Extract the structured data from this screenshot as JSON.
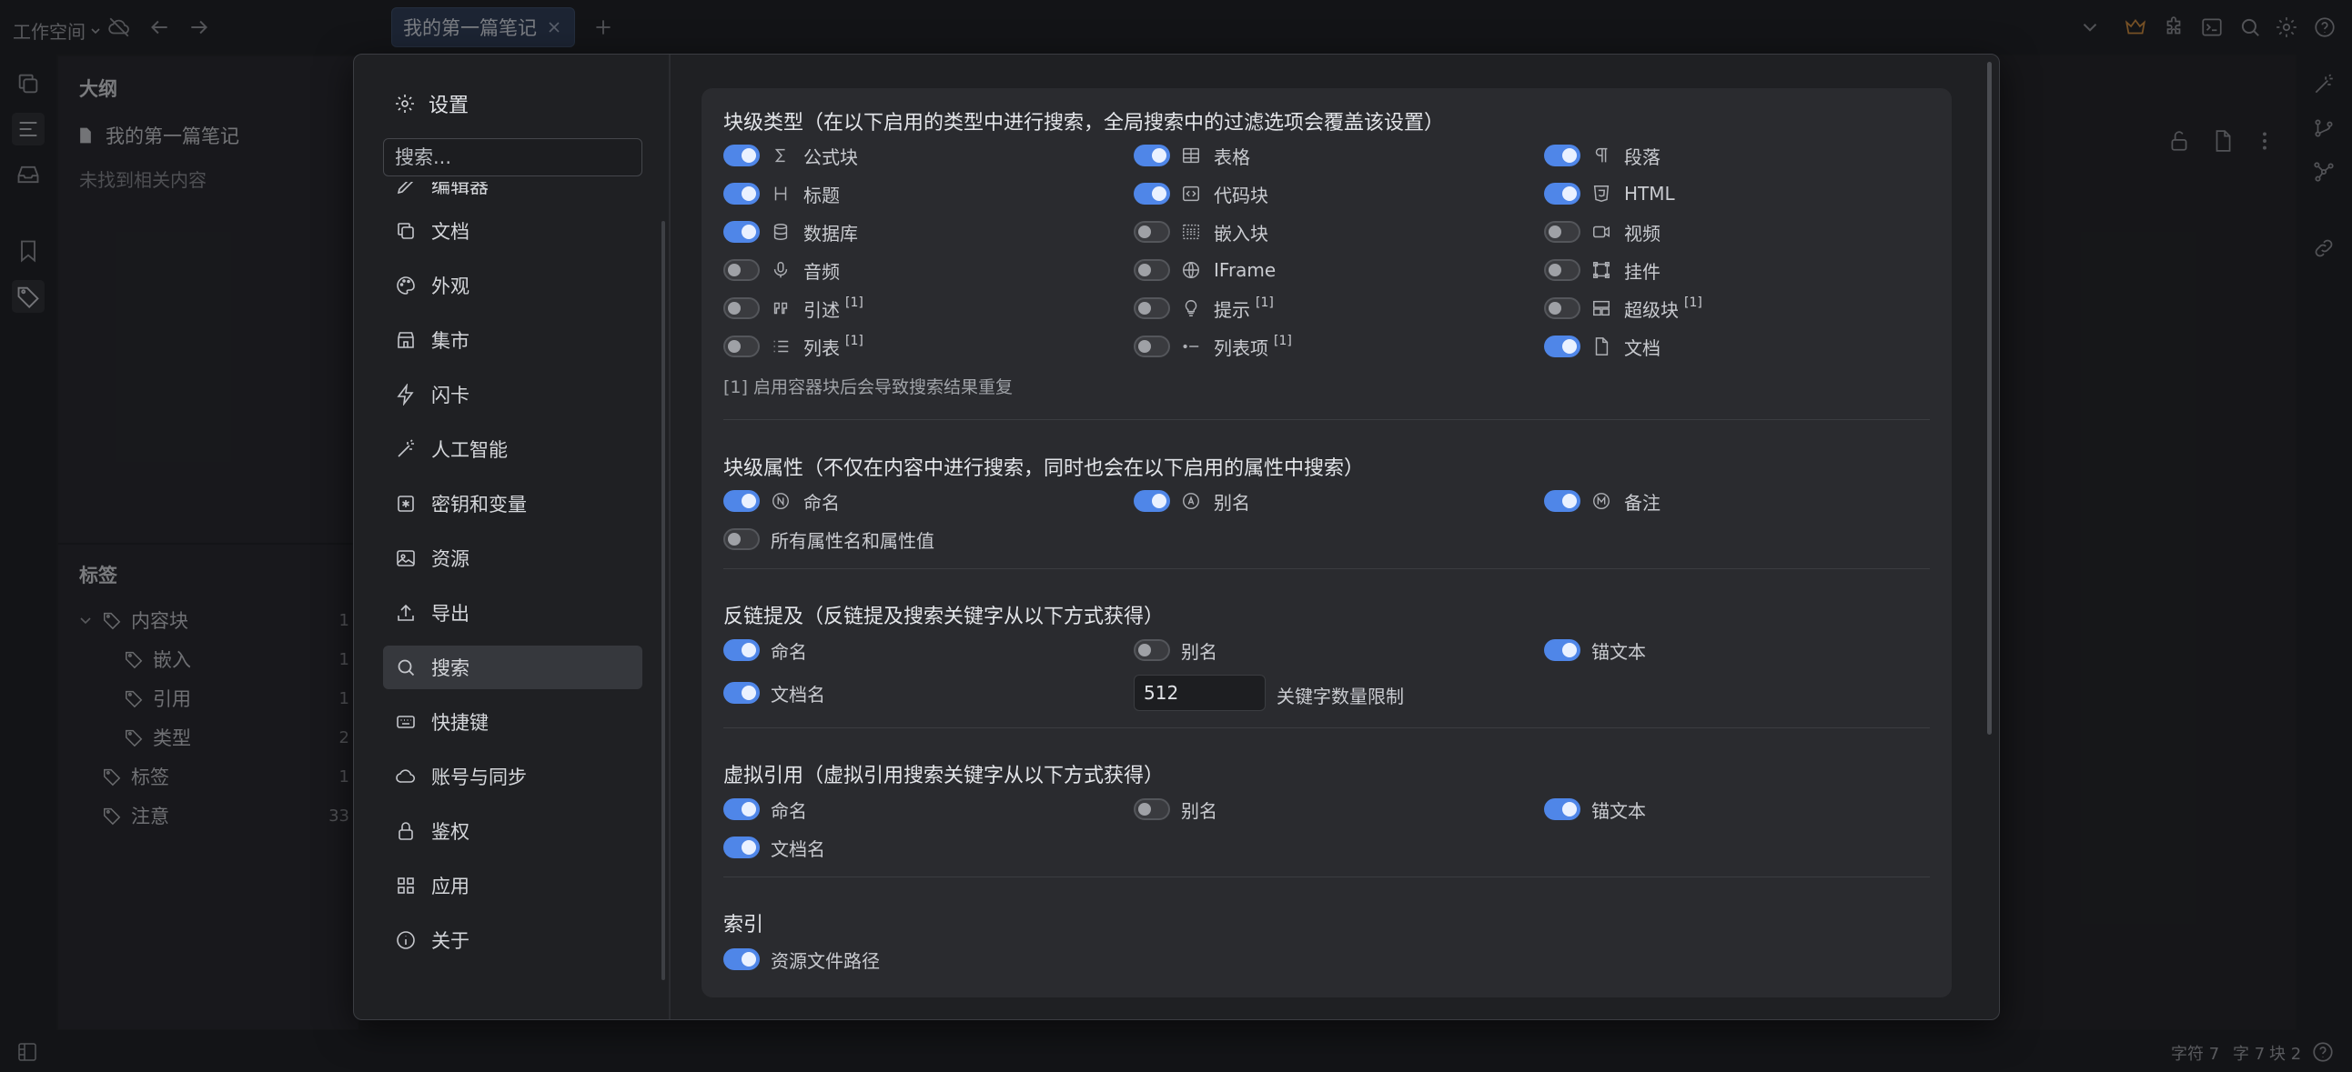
{
  "topbar": {
    "workspace": "工作空间",
    "tab_title": "我的第一篇笔记"
  },
  "outline": {
    "title": "大纲",
    "doc_title": "我的第一篇笔记",
    "empty_text": "未找到相关内容"
  },
  "tags": {
    "title": "标签",
    "items": [
      {
        "label": "内容块",
        "count": "1"
      },
      {
        "label": "嵌入",
        "count": "1"
      },
      {
        "label": "引用",
        "count": "1"
      },
      {
        "label": "类型",
        "count": "2"
      },
      {
        "label": "标签",
        "count": "1"
      },
      {
        "label": "注意",
        "count": "33"
      }
    ]
  },
  "status": {
    "chars": "字符 7",
    "words": "字 7",
    "blocks": "块 2"
  },
  "dialog": {
    "title": "设置",
    "search_placeholder": "搜索...",
    "nav": [
      {
        "label": "编辑器",
        "icon": "pen-icon"
      },
      {
        "label": "文档",
        "icon": "files-icon"
      },
      {
        "label": "外观",
        "icon": "palette-icon"
      },
      {
        "label": "集市",
        "icon": "store-icon"
      },
      {
        "label": "闪卡",
        "icon": "bolt-icon"
      },
      {
        "label": "人工智能",
        "icon": "magic-wand-icon"
      },
      {
        "label": "密钥和变量",
        "icon": "key-icon"
      },
      {
        "label": "资源",
        "icon": "image-icon"
      },
      {
        "label": "导出",
        "icon": "upload-icon"
      },
      {
        "label": "搜索",
        "icon": "search-icon"
      },
      {
        "label": "快捷键",
        "icon": "keyboard-icon"
      },
      {
        "label": "账号与同步",
        "icon": "cloud-icon"
      },
      {
        "label": "鉴权",
        "icon": "lock-icon"
      },
      {
        "label": "应用",
        "icon": "grid-icon"
      },
      {
        "label": "关于",
        "icon": "info-icon"
      }
    ],
    "active_nav": "搜索"
  },
  "search_settings": {
    "block_types": {
      "title": "块级类型（在以下启用的类型中进行搜索，全局搜索中的过滤选项会覆盖该设置）",
      "items": [
        {
          "label": "公式块",
          "icon": "sigma-icon",
          "on": true,
          "note": ""
        },
        {
          "label": "表格",
          "icon": "table-icon",
          "on": true,
          "note": ""
        },
        {
          "label": "段落",
          "icon": "paragraph-icon",
          "on": true,
          "note": ""
        },
        {
          "label": "标题",
          "icon": "heading-icon",
          "on": true,
          "note": ""
        },
        {
          "label": "代码块",
          "icon": "code-icon",
          "on": true,
          "note": ""
        },
        {
          "label": "HTML",
          "icon": "html5-icon",
          "on": true,
          "note": ""
        },
        {
          "label": "数据库",
          "icon": "database-icon",
          "on": true,
          "note": ""
        },
        {
          "label": "嵌入块",
          "icon": "embed-icon",
          "on": false,
          "note": ""
        },
        {
          "label": "视频",
          "icon": "video-icon",
          "on": false,
          "note": ""
        },
        {
          "label": "音频",
          "icon": "microphone-icon",
          "on": false,
          "note": ""
        },
        {
          "label": "IFrame",
          "icon": "globe-icon",
          "on": false,
          "note": ""
        },
        {
          "label": "挂件",
          "icon": "widget-icon",
          "on": false,
          "note": ""
        },
        {
          "label": "引述",
          "icon": "quote-icon",
          "on": false,
          "note": "[1]"
        },
        {
          "label": "提示",
          "icon": "lightbulb-icon",
          "on": false,
          "note": "[1]"
        },
        {
          "label": "超级块",
          "icon": "superblock-icon",
          "on": false,
          "note": "[1]"
        },
        {
          "label": "列表",
          "icon": "list-icon",
          "on": false,
          "note": "[1]"
        },
        {
          "label": "列表项",
          "icon": "list-item-icon",
          "on": false,
          "note": "[1]"
        },
        {
          "label": "文档",
          "icon": "file-icon",
          "on": true,
          "note": ""
        }
      ],
      "footnote": "[1] 启用容器块后会导致搜索结果重复"
    },
    "block_attrs": {
      "title": "块级属性（不仅在内容中进行搜索，同时也会在以下启用的属性中搜索）",
      "items": [
        {
          "label": "命名",
          "icon": "circle-n-icon",
          "on": true
        },
        {
          "label": "别名",
          "icon": "circle-a-icon",
          "on": true
        },
        {
          "label": "备注",
          "icon": "circle-m-icon",
          "on": true
        },
        {
          "label": "所有属性名和属性值",
          "icon": "",
          "on": false
        }
      ]
    },
    "backlinks": {
      "title": "反链提及（反链提及搜索关键字从以下方式获得）",
      "items": [
        {
          "label": "命名",
          "on": true
        },
        {
          "label": "别名",
          "on": false
        },
        {
          "label": "锚文本",
          "on": true
        },
        {
          "label": "文档名",
          "on": true
        }
      ],
      "keyword_limit_value": "512",
      "keyword_limit_label": "关键字数量限制"
    },
    "virtual_refs": {
      "title": "虚拟引用（虚拟引用搜索关键字从以下方式获得）",
      "items": [
        {
          "label": "命名",
          "on": true
        },
        {
          "label": "别名",
          "on": false
        },
        {
          "label": "锚文本",
          "on": true
        },
        {
          "label": "文档名",
          "on": true
        }
      ]
    },
    "index": {
      "title": "索引",
      "items": [
        {
          "label": "资源文件路径",
          "on": true
        }
      ]
    }
  },
  "colors": {
    "accent": "#4f86e8",
    "tab_bg": "#2b3a52",
    "crown": "#d08a3a"
  }
}
